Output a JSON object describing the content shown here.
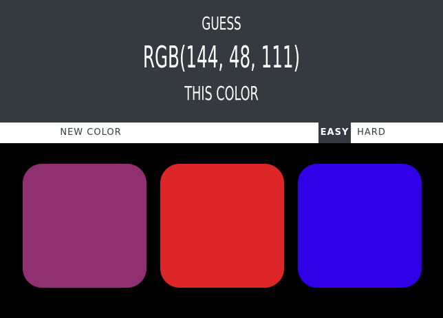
{
  "header": {
    "guess": "GUESS",
    "rgb": "RGB(144, 48, 111)",
    "this_color": "THIS COLOR",
    "background": "#343a40"
  },
  "stripe": {
    "new_color": "NEW COLOR",
    "easy": "EASY",
    "hard": "HARD",
    "selected_mode": "EASY"
  },
  "squares": [
    {
      "color": "#913070"
    },
    {
      "color": "#dc2628"
    },
    {
      "color": "#3200e6"
    }
  ],
  "page_background": "#000000"
}
